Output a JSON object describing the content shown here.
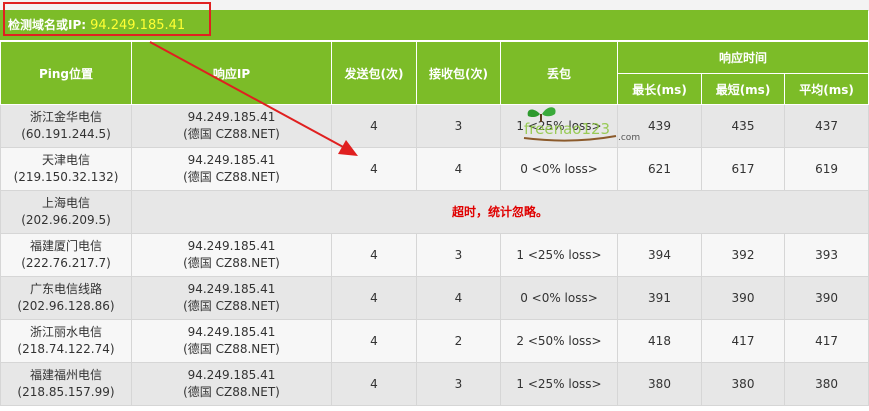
{
  "title": {
    "label": "检测域名或IP:",
    "ip": "94.249.185.41"
  },
  "headers": {
    "ping_location": "Ping位置",
    "response_ip": "响应IP",
    "sent": "发送包(次)",
    "received": "接收包(次)",
    "loss": "丢包",
    "response_time": "响应时间",
    "max": "最长(ms)",
    "min": "最短(ms)",
    "avg": "平均(ms)"
  },
  "rows": [
    {
      "loc": "浙江金华电信",
      "loc_ip": "(60.191.244.5)",
      "ip": "94.249.185.41",
      "ip_note": "(德国 CZ88.NET)",
      "sent": "4",
      "recv": "3",
      "loss": "1 <25% loss>",
      "max": "439",
      "min": "435",
      "avg": "437"
    },
    {
      "loc": "天津电信",
      "loc_ip": "(219.150.32.132)",
      "ip": "94.249.185.41",
      "ip_note": "(德国 CZ88.NET)",
      "sent": "4",
      "recv": "4",
      "loss": "0 <0% loss>",
      "max": "621",
      "min": "617",
      "avg": "619"
    },
    {
      "loc": "上海电信",
      "loc_ip": "(202.96.209.5)",
      "timeout": "超时，统计忽略。"
    },
    {
      "loc": "福建厦门电信",
      "loc_ip": "(222.76.217.7)",
      "ip": "94.249.185.41",
      "ip_note": "(德国 CZ88.NET)",
      "sent": "4",
      "recv": "3",
      "loss": "1 <25% loss>",
      "max": "394",
      "min": "392",
      "avg": "393"
    },
    {
      "loc": "广东电信线路",
      "loc_ip": "(202.96.128.86)",
      "ip": "94.249.185.41",
      "ip_note": "(德国 CZ88.NET)",
      "sent": "4",
      "recv": "4",
      "loss": "0 <0% loss>",
      "max": "391",
      "min": "390",
      "avg": "390"
    },
    {
      "loc": "浙江丽水电信",
      "loc_ip": "(218.74.122.74)",
      "ip": "94.249.185.41",
      "ip_note": "(德国 CZ88.NET)",
      "sent": "4",
      "recv": "2",
      "loss": "2 <50% loss>",
      "max": "418",
      "min": "417",
      "avg": "417"
    },
    {
      "loc": "福建福州电信",
      "loc_ip": "(218.85.157.99)",
      "ip": "94.249.185.41",
      "ip_note": "(德国 CZ88.NET)",
      "sent": "4",
      "recv": "3",
      "loss": "1 <25% loss>",
      "max": "380",
      "min": "380",
      "avg": "380"
    }
  ],
  "watermark": {
    "text": "freenao123",
    "suffix": ".com"
  },
  "colors": {
    "header": "#7cbc28",
    "ip_highlight": "#ffff33",
    "annotation": "#e02020",
    "timeout": "#e00000"
  }
}
